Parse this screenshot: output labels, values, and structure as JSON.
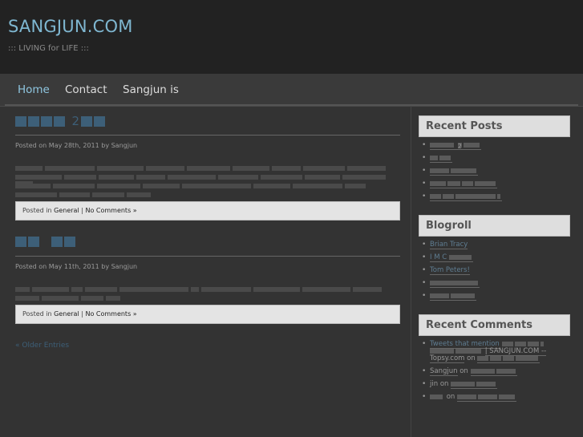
{
  "site": {
    "title": "SANGJUN.COM",
    "tagline": "::: LIVING for LIFE :::"
  },
  "nav": {
    "items": [
      "Home",
      "Contact",
      "Sangjun is"
    ]
  },
  "posts": [
    {
      "title_suffix": "2",
      "meta": "Posted on May 28th, 2011 by Sangjun",
      "footer": {
        "prefix": "Posted in",
        "category": "General",
        "sep": "|",
        "comments": "No Comments »"
      }
    },
    {
      "meta": "Posted on May 11th, 2011 by Sangjun",
      "footer": {
        "prefix": "Posted in",
        "category": "General",
        "sep": "|",
        "comments": "No Comments »"
      }
    }
  ],
  "older_entries": "« Older Entries",
  "sidebar": {
    "recent_posts_title": "Recent Posts",
    "recent_posts_suffix": "2",
    "blogroll_title": "Blogroll",
    "blogroll": [
      "Brian Tracy",
      "I M C",
      "Tom Peters!"
    ],
    "recent_comments_title": "Recent Comments",
    "comments": {
      "c1_prefix": "Tweets that mention",
      "c1_middle": "| SANGJUN.COM --",
      "c1_source": "Topsy.com",
      "c1_on": "on",
      "c2_author": "Sangjun",
      "c2_on": "on",
      "c3_author": "jin",
      "c3_on": "on",
      "c4_on": "on"
    }
  }
}
